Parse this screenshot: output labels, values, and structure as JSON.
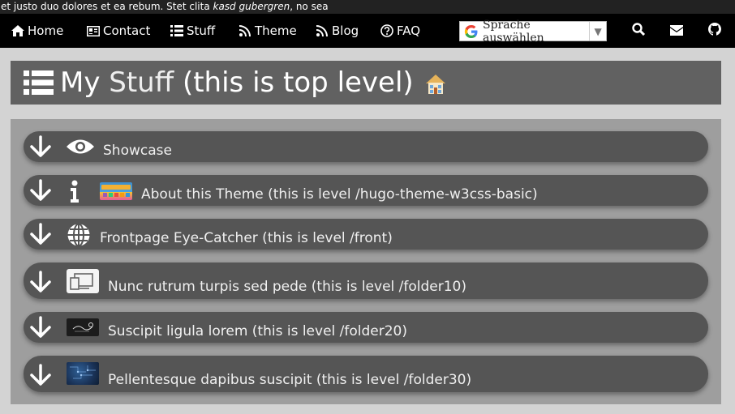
{
  "ticker": {
    "text_a": "et justo duo dolores et ea rebum. Stet clita ",
    "text_em": "kasd gubergren",
    "text_b": ", no sea"
  },
  "nav": {
    "items": [
      {
        "label": "Home",
        "icon": "home-icon"
      },
      {
        "label": "Contact",
        "icon": "address-card-icon"
      },
      {
        "label": "Stuff",
        "icon": "list-icon"
      },
      {
        "label": "Theme",
        "icon": "rss-icon"
      },
      {
        "label": "Blog",
        "icon": "rss-icon"
      },
      {
        "label": "FAQ",
        "icon": "question-circle-icon"
      }
    ],
    "translate_label": "Sprache auswählen",
    "right_icons": [
      "search-icon",
      "envelope-icon",
      "github-icon"
    ]
  },
  "page": {
    "title_part1": "My ",
    "title_part2": "Stuff",
    "title_part3": " (this is top level)"
  },
  "rows": [
    {
      "label": "Showcase",
      "icon": "eye-icon"
    },
    {
      "label": "About this Theme (this is level /hugo-theme-w3css-basic)",
      "icon": "info-icon",
      "thumb": "gohugo-logo"
    },
    {
      "label": "Frontpage Eye-Catcher (this is level /front)",
      "icon": "globe-icon"
    },
    {
      "label": "Nunc rutrum turpis sed pede (this is level /folder10)",
      "icon": "devices-thumbnail"
    },
    {
      "label": "Suscipit ligula lorem (this is level /folder20)",
      "icon": "dark-thumbnail"
    },
    {
      "label": "Pellentesque dapibus suscipit (this is level /folder30)",
      "icon": "blue-thumbnail"
    }
  ],
  "colors": {
    "navbar": "#000000",
    "title_bar": "#616161",
    "panel": "#9e9e9e",
    "row": "#555555",
    "background": "#d3d3d3"
  }
}
